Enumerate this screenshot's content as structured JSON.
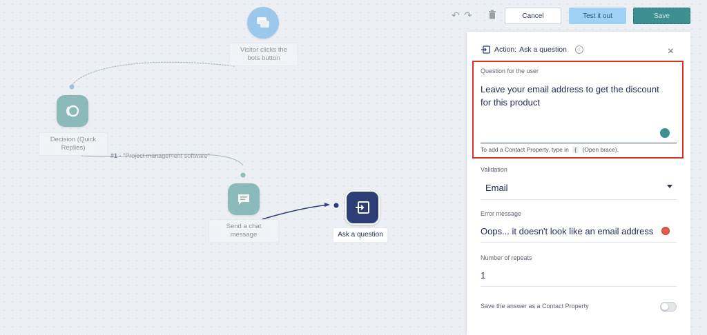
{
  "toolbar": {
    "cancel_label": "Cancel",
    "test_label": "Test it out",
    "save_label": "Save",
    "undo_icon": "undo-icon",
    "redo_icon": "redo-icon",
    "delete_icon": "trash-icon"
  },
  "flow": {
    "trigger_label": "Visitor clicks the bots button",
    "decision_label": "Decision (Quick Replies)",
    "edge_label_num": "#1 -",
    "edge_label_text": "\"Project management software\"",
    "chat_label": "Send a chat message",
    "ask_label": "Ask a question"
  },
  "panel": {
    "header_prefix": "Action:",
    "header_title": "Ask a question",
    "info_icon": "info-icon",
    "close_icon": "close-icon",
    "question": {
      "label": "Question for the user",
      "value_line1": "Leave your email address to get the discount",
      "value_line2": "for this product",
      "hint_prefix": "To add a Contact Property, type in",
      "hint_key": "{",
      "hint_suffix": "(Open brace)."
    },
    "validation": {
      "label": "Validation",
      "value": "Email"
    },
    "error": {
      "label": "Error message",
      "value": "Oops... it doesn't look like an email address"
    },
    "repeats": {
      "label": "Number of repeats",
      "value": "1"
    },
    "save_property": {
      "label": "Save the answer as a Contact Property",
      "enabled": false
    }
  },
  "colors": {
    "accent": "#2c3e75",
    "teal": "#3e8f8f",
    "highlight_border": "#d8342a",
    "test_button": "#9fd1f4",
    "save_button": "#3e8f8f"
  }
}
